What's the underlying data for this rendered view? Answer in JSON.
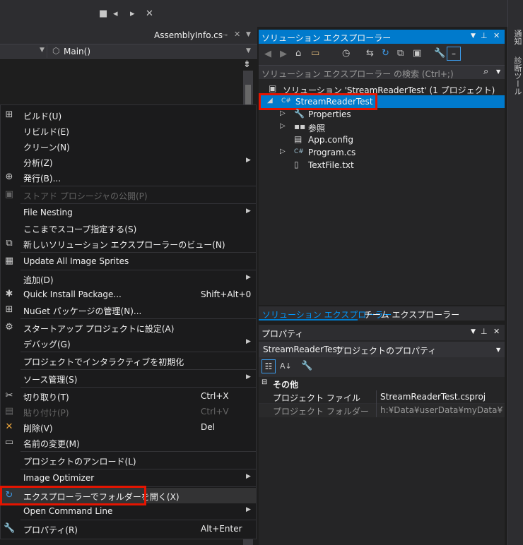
{
  "editor": {
    "doc_tab": "AssemblyInfo.cs",
    "nav_member": "Main()"
  },
  "right_rail": {
    "item1": "通知",
    "item2": "診断ツール"
  },
  "context_menu": {
    "items": [
      {
        "label": "ビルド(U)",
        "icon": "build-icon"
      },
      {
        "label": "リビルド(E)"
      },
      {
        "label": "クリーン(N)"
      },
      {
        "label": "分析(Z)",
        "submenu": true
      },
      {
        "label": "発行(B)...",
        "icon": "globe-icon"
      },
      {
        "label": "ストアド プロシージャの公開(P)",
        "disabled": true,
        "icon": "publish-icon"
      },
      {
        "label": "File Nesting",
        "submenu": true
      },
      {
        "label": "ここまでスコープ指定する(S)"
      },
      {
        "label": "新しいソリューション エクスプローラーのビュー(N)",
        "icon": "new-view-icon"
      },
      {
        "label": "Update All Image Sprites",
        "icon": "sprites-icon"
      },
      {
        "label": "追加(D)",
        "submenu": true
      },
      {
        "label": "Quick Install Package...",
        "shortcut": "Shift+Alt+0",
        "icon": "package-icon"
      },
      {
        "label": "NuGet パッケージの管理(N)...",
        "icon": "nuget-icon"
      },
      {
        "label": "スタートアップ プロジェクトに設定(A)",
        "icon": "gear-icon"
      },
      {
        "label": "デバッグ(G)",
        "submenu": true
      },
      {
        "label": "プロジェクトでインタラクティブを初期化"
      },
      {
        "label": "ソース管理(S)",
        "submenu": true
      },
      {
        "label": "切り取り(T)",
        "shortcut": "Ctrl+X",
        "icon": "scissors-icon"
      },
      {
        "label": "貼り付け(P)",
        "shortcut": "Ctrl+V",
        "disabled": true,
        "icon": "paste-icon"
      },
      {
        "label": "削除(V)",
        "shortcut": "Del",
        "icon": "delete-icon"
      },
      {
        "label": "名前の変更(M)",
        "icon": "rename-icon"
      },
      {
        "label": "プロジェクトのアンロード(L)"
      },
      {
        "label": "Image Optimizer",
        "submenu": true
      },
      {
        "label": "エクスプローラーでフォルダーを開く(X)",
        "icon": "refresh-folder-icon"
      },
      {
        "label": "Open Command Line",
        "submenu": true
      },
      {
        "label": "プロパティ(R)",
        "shortcut": "Alt+Enter",
        "icon": "wrench-icon"
      }
    ]
  },
  "solution_explorer": {
    "title": "ソリューション エクスプローラー",
    "search_placeholder": "ソリューション エクスプローラー の検索 (Ctrl+;)",
    "solution_label": "ソリューション 'StreamReaderTest' (1 プロジェクト)",
    "project_label": "StreamReaderTest",
    "children": [
      "Properties",
      "参照",
      "App.config",
      "Program.cs",
      "TextFile.txt"
    ],
    "tabs": [
      "ソリューション エクスプローラー",
      "チーム エクスプローラー"
    ]
  },
  "properties": {
    "title": "プロパティ",
    "object_name": "StreamReaderTest",
    "object_type": "プロジェクトのプロパティ",
    "category": "その他",
    "rows": [
      {
        "name": "プロジェクト ファイル",
        "value": "StreamReaderTest.csproj"
      },
      {
        "name": "プロジェクト フォルダー",
        "value": "h:¥Data¥userData¥myData¥Visual"
      }
    ]
  },
  "colors": {
    "accent": "#007acc",
    "highlight_box": "#e51400"
  }
}
